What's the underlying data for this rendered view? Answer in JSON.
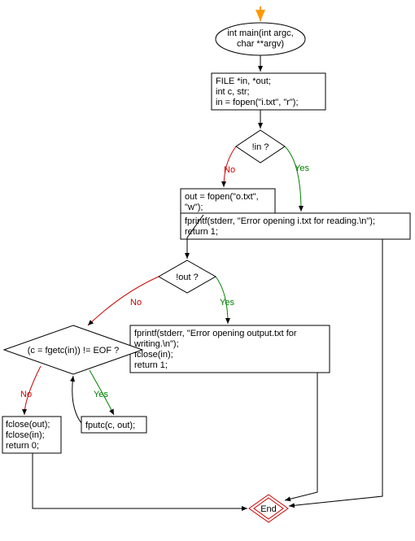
{
  "chart_data": {
    "type": "flowchart",
    "nodes": [
      {
        "id": "start",
        "shape": "entry-arrow"
      },
      {
        "id": "main",
        "shape": "terminator",
        "text": "int main(int argc,\nchar **argv)"
      },
      {
        "id": "init",
        "shape": "process",
        "text": "FILE *in, *out;\nint c, str;\nin = fopen(\"i.txt\", \"r\");"
      },
      {
        "id": "check_in",
        "shape": "decision",
        "text": "!in ?"
      },
      {
        "id": "err_in",
        "shape": "process",
        "text": "fprintf(stderr, \"Error opening i.txt for reading.\\n\");\nreturn 1;"
      },
      {
        "id": "open_out",
        "shape": "process",
        "text": "out = fopen(\"o.txt\",\n\"w\");"
      },
      {
        "id": "check_out",
        "shape": "decision",
        "text": "!out ?"
      },
      {
        "id": "err_out",
        "shape": "process",
        "text": "fprintf(stderr, \"Error opening output.txt for\nwriting.\\n\");\nfclose(in);\nreturn 1;"
      },
      {
        "id": "loop",
        "shape": "decision",
        "text": "(c = fgetc(in)) != EOF ?"
      },
      {
        "id": "fputc",
        "shape": "process",
        "text": "fputc(c, out);"
      },
      {
        "id": "close",
        "shape": "process",
        "text": "fclose(out);\nfclose(in);\nreturn 0;"
      },
      {
        "id": "end",
        "shape": "end",
        "text": "End"
      }
    ],
    "edges": [
      {
        "from": "start",
        "to": "main"
      },
      {
        "from": "main",
        "to": "init"
      },
      {
        "from": "init",
        "to": "check_in"
      },
      {
        "from": "check_in",
        "to": "err_in",
        "label": "Yes"
      },
      {
        "from": "check_in",
        "to": "open_out",
        "label": "No"
      },
      {
        "from": "open_out",
        "to": "check_out"
      },
      {
        "from": "check_out",
        "to": "err_out",
        "label": "Yes"
      },
      {
        "from": "check_out",
        "to": "loop",
        "label": "No"
      },
      {
        "from": "loop",
        "to": "fputc",
        "label": "Yes"
      },
      {
        "from": "fputc",
        "to": "loop"
      },
      {
        "from": "loop",
        "to": "close",
        "label": "No"
      },
      {
        "from": "close",
        "to": "end"
      },
      {
        "from": "err_in",
        "to": "end"
      },
      {
        "from": "err_out",
        "to": "end"
      }
    ]
  },
  "labels": {
    "main_l1": "int main(int argc,",
    "main_l2": "char **argv)",
    "init_l1": "FILE *in, *out;",
    "init_l2": "int c, str;",
    "init_l3": "in = fopen(\"i.txt\", \"r\");",
    "check_in": "!in ?",
    "err_in_l1": "fprintf(stderr, \"Error opening i.txt for reading.\\n\");",
    "err_in_l2": "return 1;",
    "open_out_l1": "out = fopen(\"o.txt\",",
    "open_out_l2": "\"w\");",
    "check_out": "!out ?",
    "err_out_l1": "fprintf(stderr, \"Error opening output.txt for",
    "err_out_l2": "writing.\\n\");",
    "err_out_l3": "fclose(in);",
    "err_out_l4": "return 1;",
    "loop": "(c = fgetc(in)) != EOF ?",
    "fputc": "fputc(c, out);",
    "close_l1": "fclose(out);",
    "close_l2": "fclose(in);",
    "close_l3": "return 0;",
    "end": "End",
    "yes": "Yes",
    "no": "No"
  }
}
